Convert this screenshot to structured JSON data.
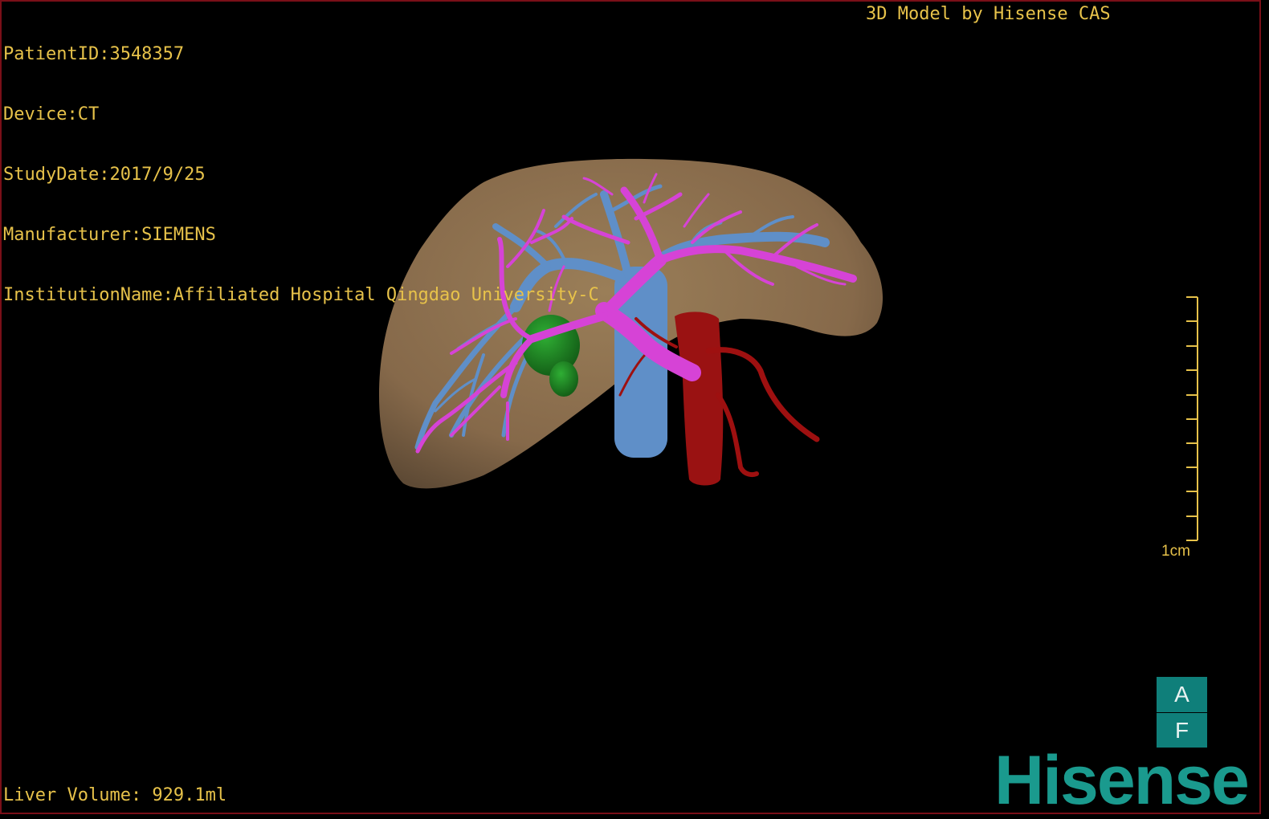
{
  "overlay": {
    "patient_id": "PatientID:3548357",
    "device": "Device:CT",
    "study_date": "StudyDate:2017/9/25",
    "manufacturer": "Manufacturer:SIEMENS",
    "institution": "InstitutionName:Affiliated Hospital Qingdao University-C",
    "header_right": "3D Model by Hisense CAS",
    "liver_volume": "Liver Volume: 929.1ml",
    "scale_label": "1cm"
  },
  "orientation": {
    "top_face": "A",
    "bottom_face": "F"
  },
  "brand": {
    "logo_text": "Hisense"
  },
  "colors": {
    "text": "#e7c24a",
    "liver": "#8a6e4b",
    "portal_vein": "#d643d6",
    "hepatic_vein": "#5f8fc8",
    "artery": "#9e1010",
    "lesion": "#1e8a22",
    "brand": "#1a9a8e",
    "frame_border": "#7a0f18"
  }
}
